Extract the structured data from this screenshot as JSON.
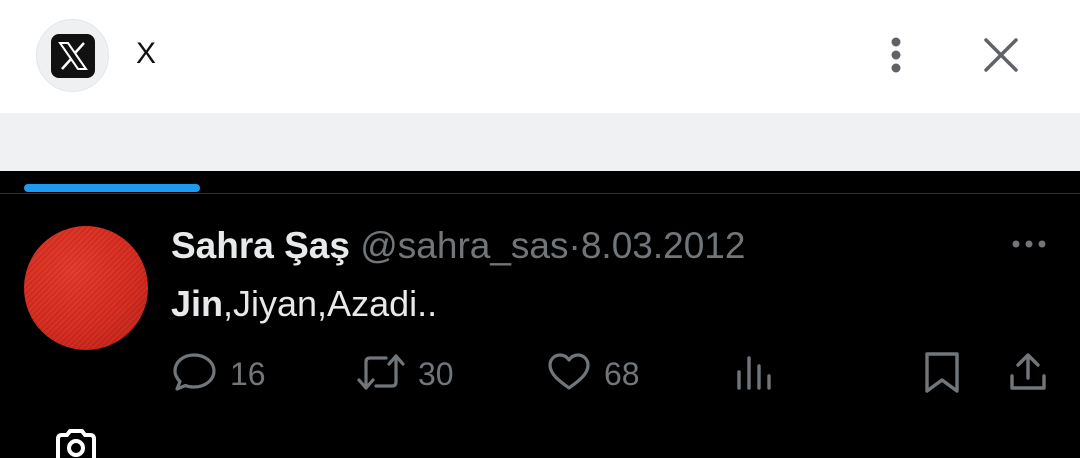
{
  "browser_bar": {
    "title": "X",
    "app_icon": "x-logo-icon",
    "menu_icon": "more-vertical-icon",
    "close_icon": "close-icon"
  },
  "tweet": {
    "display_name": "Sahra Şaş",
    "handle": "@sahra_sas",
    "separator": "·",
    "date": "8.03.2012",
    "text_bold": "Jin",
    "text_rest": ",Jiyan,Azadi..",
    "actions": {
      "reply_count": "16",
      "retweet_count": "30",
      "like_count": "68"
    }
  },
  "colors": {
    "accent": "#1d9bf0",
    "background": "#000000",
    "text_primary": "#e7e9ea",
    "text_secondary": "#71767b",
    "avatar": "#d72a1e"
  }
}
